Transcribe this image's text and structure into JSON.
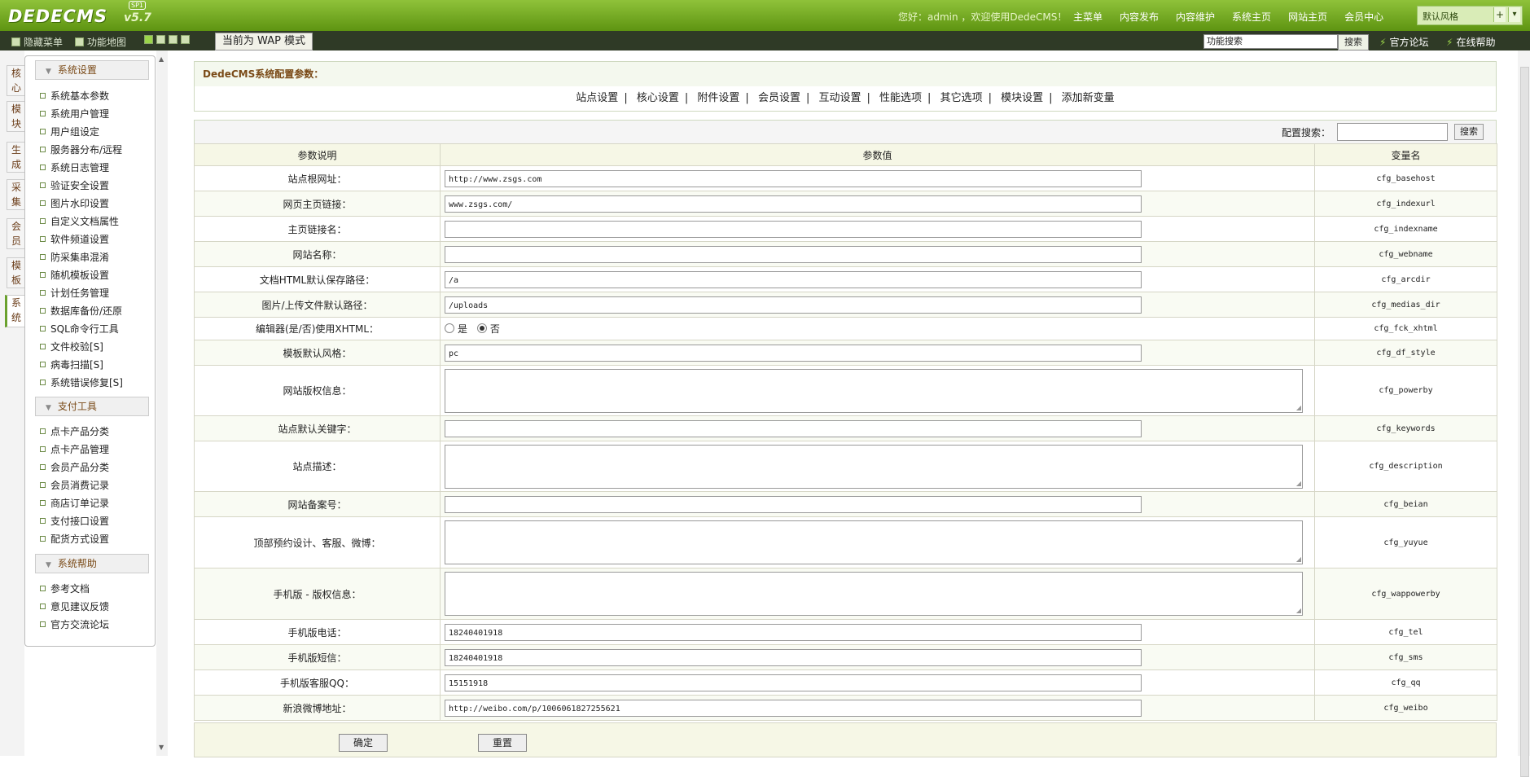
{
  "header": {
    "logo": "DEDECMS",
    "version": "v5.7",
    "edition": "SP1",
    "greeting": "您好：admin ，欢迎使用DedeCMS！",
    "nav": [
      "主菜单",
      "内容发布",
      "内容维护",
      "系统主页",
      "网站主页",
      "会员中心"
    ],
    "skin_select": "默认风格"
  },
  "toolbar": {
    "hide_menu": "隐藏菜单",
    "function_map": "功能地图",
    "wap_mode": "当前为 WAP 模式",
    "function_search_placeholder": "功能搜索",
    "function_search_button": "搜索",
    "forum_link": "官方论坛",
    "help_link": "在线帮助"
  },
  "side_tabs": [
    "核心",
    "模块",
    "生成",
    "采集",
    "会员",
    "模板",
    "系统"
  ],
  "active_side_tab": "系统",
  "left_menu": {
    "groups": [
      {
        "title": "系统设置",
        "items": [
          "系统基本参数",
          "系统用户管理",
          "用户组设定",
          "服务器分布/远程",
          "系统日志管理",
          "验证安全设置",
          "图片水印设置",
          "自定义文档属性",
          "软件频道设置",
          "防采集串混淆",
          "随机模板设置",
          "计划任务管理",
          "数据库备份/还原",
          "SQL命令行工具",
          "文件校验[S]",
          "病毒扫描[S]",
          "系统错误修复[S]"
        ]
      },
      {
        "title": "支付工具",
        "items": [
          "点卡产品分类",
          "点卡产品管理",
          "会员产品分类",
          "会员消费记录",
          "商店订单记录",
          "支付接口设置",
          "配货方式设置"
        ]
      },
      {
        "title": "系统帮助",
        "items": [
          "参考文档",
          "意见建议反馈",
          "官方交流论坛"
        ]
      }
    ]
  },
  "main": {
    "title": "DedeCMS系统配置参数：",
    "tabs": [
      "站点设置",
      "核心设置",
      "附件设置",
      "会员设置",
      "互动设置",
      "性能选项",
      "其它选项",
      "模块设置",
      "添加新变量"
    ],
    "search_label": "配置搜索：",
    "search_button": "搜索",
    "columns": [
      "参数说明",
      "参数值",
      "变量名"
    ],
    "rows": [
      {
        "label": "站点根网址：",
        "type": "text",
        "value": "http://www.zsgs.com",
        "var": "cfg_basehost"
      },
      {
        "label": "网页主页链接：",
        "type": "text",
        "value": "www.zsgs.com/",
        "var": "cfg_indexurl"
      },
      {
        "label": "主页链接名：",
        "type": "text",
        "value": "",
        "var": "cfg_indexname"
      },
      {
        "label": "网站名称：",
        "type": "text",
        "value": "",
        "var": "cfg_webname"
      },
      {
        "label": "文档HTML默认保存路径：",
        "type": "text",
        "value": "/a",
        "var": "cfg_arcdir"
      },
      {
        "label": "图片/上传文件默认路径：",
        "type": "text",
        "value": "/uploads",
        "var": "cfg_medias_dir"
      },
      {
        "label": "编辑器(是/否)使用XHTML：",
        "type": "radio",
        "options": [
          "是",
          "否"
        ],
        "selected": "否",
        "var": "cfg_fck_xhtml"
      },
      {
        "label": "模板默认风格：",
        "type": "text",
        "value": "pc",
        "var": "cfg_df_style"
      },
      {
        "label": "网站版权信息：",
        "type": "textarea",
        "value": "",
        "var": "cfg_powerby"
      },
      {
        "label": "站点默认关键字：",
        "type": "text",
        "value": "",
        "var": "cfg_keywords"
      },
      {
        "label": "站点描述：",
        "type": "textarea",
        "value": "",
        "var": "cfg_description"
      },
      {
        "label": "网站备案号：",
        "type": "text",
        "value": "",
        "var": "cfg_beian"
      },
      {
        "label": "顶部预约设计、客服、微博：",
        "type": "textarea",
        "value": "",
        "var": "cfg_yuyue"
      },
      {
        "label": "手机版 - 版权信息：",
        "type": "textarea",
        "value": "",
        "var": "cfg_wappowerby"
      },
      {
        "label": "手机版电话：",
        "type": "text",
        "value": "18240401918",
        "var": "cfg_tel"
      },
      {
        "label": "手机版短信：",
        "type": "text",
        "value": "18240401918",
        "var": "cfg_sms"
      },
      {
        "label": "手机版客服QQ：",
        "type": "text",
        "value": "15151918",
        "var": "cfg_qq"
      },
      {
        "label": "新浪微博地址：",
        "type": "text",
        "value": "http://weibo.com/p/1006061827255621",
        "var": "cfg_weibo"
      }
    ],
    "confirm_button": "确定",
    "reset_button": "重置"
  },
  "colors": {
    "brand_green": "#6aa12e",
    "dark_bar": "#2f3a26",
    "heading_brown": "#7a4a17"
  }
}
